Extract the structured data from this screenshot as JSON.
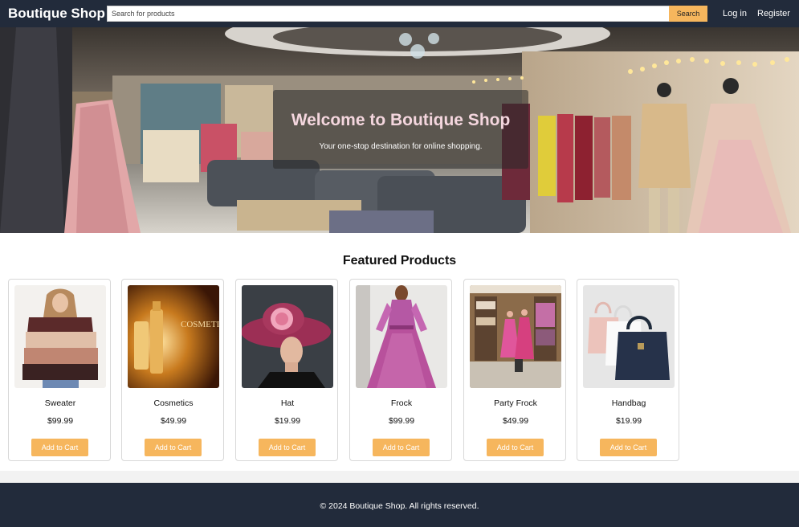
{
  "header": {
    "brand": "Boutique Shop",
    "search_placeholder": "Search for products",
    "search_button": "Search",
    "login": "Log in",
    "register": "Register"
  },
  "hero": {
    "title": "Welcome to Boutique Shop",
    "subtitle": "Your one-stop destination for online shopping."
  },
  "featured": {
    "title": "Featured Products",
    "products": [
      {
        "name": "Sweater",
        "price": "$99.99",
        "button": "Add to Cart"
      },
      {
        "name": "Cosmetics",
        "price": "$49.99",
        "button": "Add to Cart"
      },
      {
        "name": "Hat",
        "price": "$19.99",
        "button": "Add to Cart"
      },
      {
        "name": "Frock",
        "price": "$99.99",
        "button": "Add to Cart"
      },
      {
        "name": "Party Frock",
        "price": "$49.99",
        "button": "Add to Cart"
      },
      {
        "name": "Handbag",
        "price": "$19.99",
        "button": "Add to Cart"
      }
    ],
    "cosmetics_logo_text": "COSMETI"
  },
  "footer": {
    "text": "© 2024 Boutique Shop. All rights reserved."
  },
  "colors": {
    "header_bg": "#222b3b",
    "accent": "#f6b65d",
    "hero_title": "#f4d6de"
  }
}
